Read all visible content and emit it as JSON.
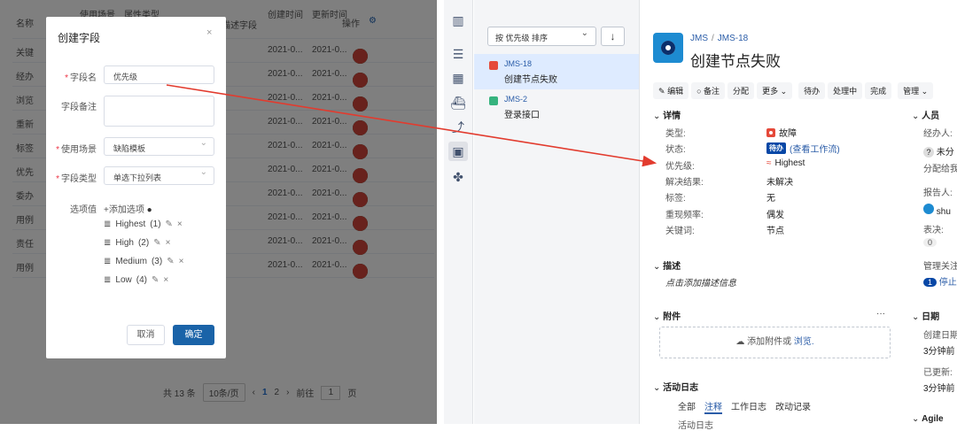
{
  "bg_table": {
    "headers": [
      "名称",
      "使用场景",
      "属性类型",
      "描述字段",
      "创建时间",
      "更新时间",
      "操作"
    ],
    "rows": [
      {
        "name": "关键",
        "created": "2021-0...",
        "updated": "2021-0..."
      },
      {
        "name": "经办",
        "created": "2021-0...",
        "updated": "2021-0..."
      },
      {
        "name": "浏览",
        "created": "2021-0...",
        "updated": "2021-0..."
      },
      {
        "name": "重新",
        "created": "2021-0...",
        "updated": "2021-0..."
      },
      {
        "name": "标签",
        "created": "2021-0...",
        "updated": "2021-0..."
      },
      {
        "name": "优先",
        "created": "2021-0...",
        "updated": "2021-0..."
      },
      {
        "name": "委办",
        "created": "2021-0...",
        "updated": "2021-0..."
      },
      {
        "name": "用例",
        "created": "2021-0...",
        "updated": "2021-0..."
      },
      {
        "name": "责任",
        "created": "2021-0...",
        "updated": "2021-0..."
      },
      {
        "name": "用例",
        "created": "2021-0...",
        "updated": "2021-0..."
      }
    ],
    "pagination": {
      "total": "共 13 条",
      "page_size": "10条/页",
      "pages": [
        "1",
        "2"
      ],
      "goto_label": "前往",
      "goto_value": "1",
      "page_suffix": "页"
    }
  },
  "dialog": {
    "title": "创建字段",
    "close": "×",
    "field_name_label": "字段名",
    "field_name_value": "优先级",
    "field_note_label": "字段备注",
    "scene_label": "使用场景",
    "scene_value": "缺陷模板",
    "type_label": "字段类型",
    "type_value": "单选下拉列表",
    "options_label": "选项值",
    "add_option": "+添加选项",
    "options": [
      {
        "label": "Highest",
        "order": "(1)"
      },
      {
        "label": "High",
        "order": "(2)"
      },
      {
        "label": "Medium",
        "order": "(3)"
      },
      {
        "label": "Low",
        "order": "(4)"
      }
    ],
    "cancel": "取消",
    "confirm": "确定"
  },
  "issue_list": {
    "sort_label": "按 优先级 排序",
    "sort_dir": "↓",
    "items": [
      {
        "key": "JMS-18",
        "summary": "创建节点失败"
      },
      {
        "key": "JMS-2",
        "summary": "登录接口"
      }
    ]
  },
  "detail": {
    "crumb_project": "JMS",
    "crumb_sep": "/",
    "crumb_key": "JMS-18",
    "title": "创建节点失败",
    "toolbar": [
      "编辑",
      "备注",
      "分配",
      "更多 ⌄",
      "待办",
      "处理中",
      "完成",
      "管理 ⌄"
    ],
    "sections": {
      "details": "详情",
      "description": "描述",
      "attachments": "附件",
      "activity": "活动日志",
      "people": "人员",
      "dates": "日期",
      "agile": "Agile"
    },
    "fields": [
      {
        "label": "类型:",
        "value": "故障"
      },
      {
        "label": "状态:",
        "value": "待办",
        "extra": "(查看工作流)"
      },
      {
        "label": "优先级:",
        "value": "Highest"
      },
      {
        "label": "解决结果:",
        "value": "未解决"
      },
      {
        "label": "标签:",
        "value": "无"
      },
      {
        "label": "重现频率:",
        "value": "偶发"
      },
      {
        "label": "关键词:",
        "value": "节点"
      }
    ],
    "description_placeholder": "点击添加描述信息",
    "attach_more": "···",
    "attach_text": "添加附件或",
    "attach_link": "浏览.",
    "activity_tabs": [
      "全部",
      "注释",
      "工作日志",
      "改动记录"
    ],
    "activity_sub": "活动日志",
    "right": {
      "assignee_label": "经办人:",
      "assignee_value": "未分",
      "assign_me": "分配给我",
      "reporter_label": "报告人:",
      "reporter_value": "shu",
      "votes_label": "表决:",
      "votes_value": "0",
      "watchers_label": "管理关注",
      "watchers_count": "1",
      "watchers_action": "停止",
      "created_label": "创建日期",
      "created_value": "3分钟前",
      "updated_label": "已更新:",
      "updated_value": "3分钟前"
    }
  }
}
